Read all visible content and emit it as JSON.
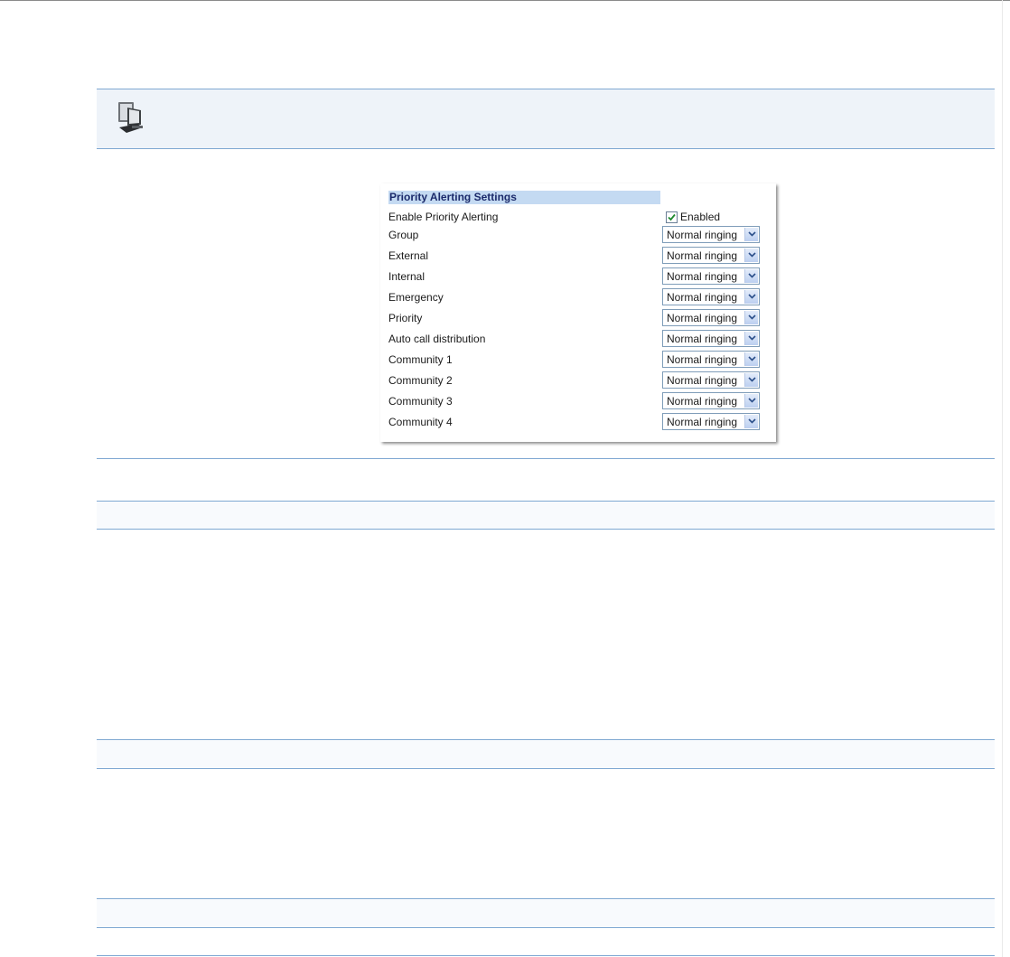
{
  "panel": {
    "title": "Priority Alerting Settings",
    "enable_row": {
      "label": "Enable Priority Alerting",
      "checked": true,
      "value_label": "Enabled"
    },
    "rows": [
      {
        "label": "Group",
        "value": "Normal ringing"
      },
      {
        "label": "External",
        "value": "Normal ringing"
      },
      {
        "label": "Internal",
        "value": "Normal ringing"
      },
      {
        "label": "Emergency",
        "value": "Normal ringing"
      },
      {
        "label": "Priority",
        "value": "Normal ringing"
      },
      {
        "label": "Auto call distribution",
        "value": "Normal ringing"
      },
      {
        "label": "Community 1",
        "value": "Normal ringing"
      },
      {
        "label": "Community 2",
        "value": "Normal ringing"
      },
      {
        "label": "Community 3",
        "value": "Normal ringing"
      },
      {
        "label": "Community 4",
        "value": "Normal ringing"
      }
    ]
  },
  "icons": {
    "web_ui": "computer-icon",
    "dropdown": "chevron-down-icon",
    "checkbox": "checkmark-icon"
  },
  "colors": {
    "rule": "#7fa8d2",
    "band": "#eef3f9",
    "header_bg": "#c4daf2",
    "header_text": "#1b2a6b"
  }
}
